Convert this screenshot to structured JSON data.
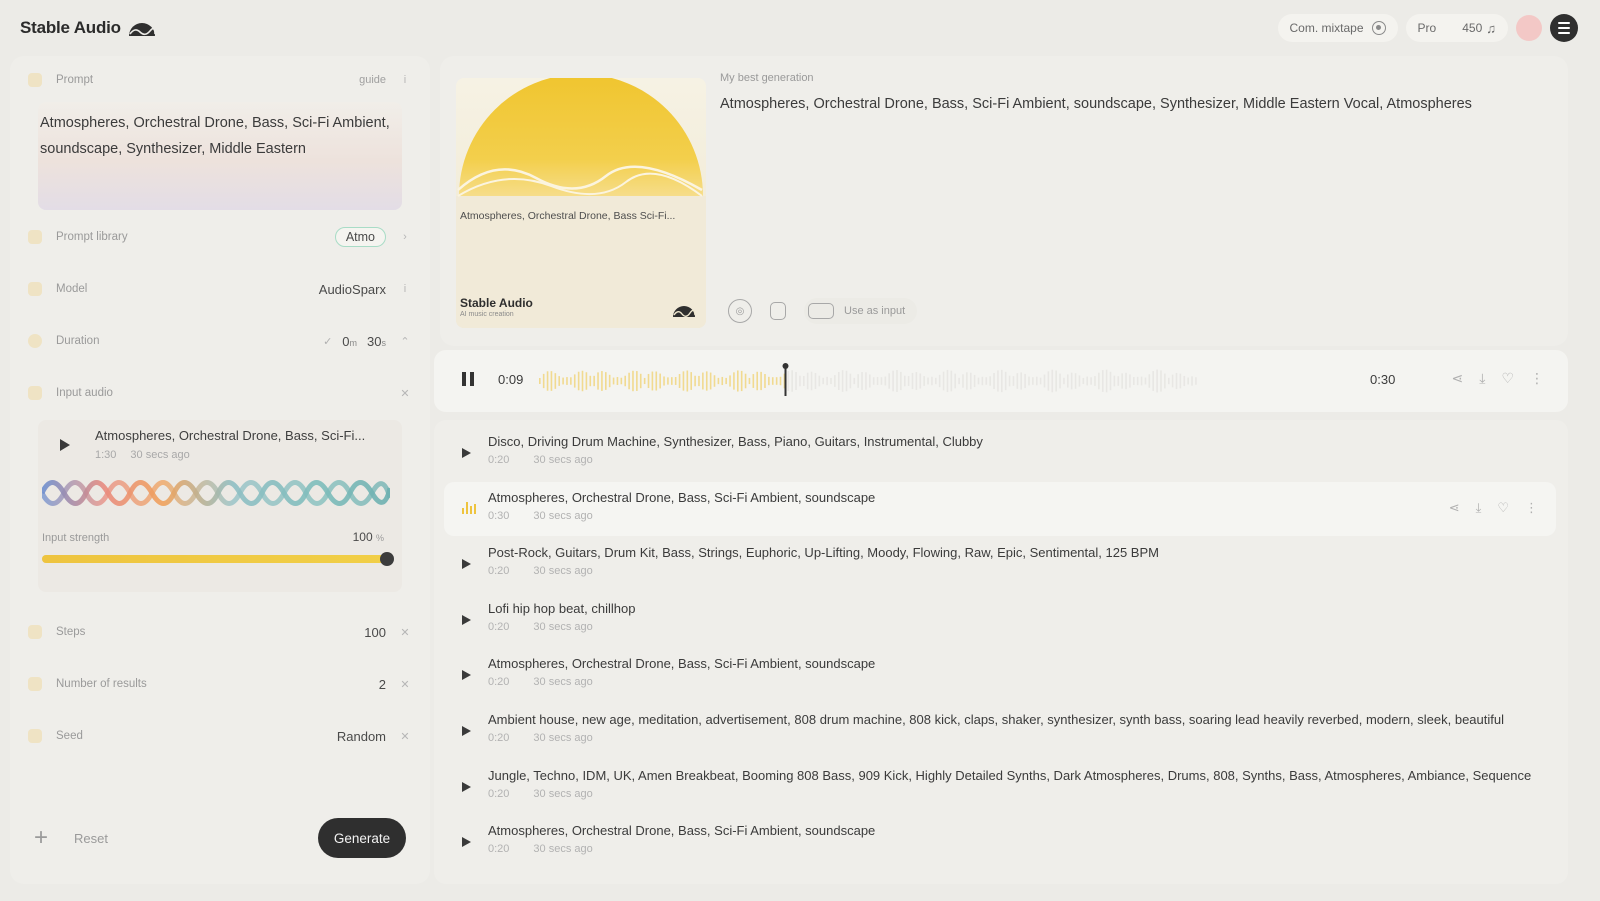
{
  "app": {
    "title": "Stable Audio"
  },
  "topbar": {
    "mixtape_label": "Com. mixtape",
    "plan_label": "Pro",
    "credits": "450"
  },
  "left": {
    "prompt": {
      "label": "Prompt",
      "guide_label": "guide",
      "text": "Atmospheres, Orchestral Drone, Bass, Sci-Fi Ambient, soundscape, Synthesizer, Middle Eastern"
    },
    "prompt_library": {
      "label": "Prompt library",
      "tag": "Atmo"
    },
    "model": {
      "label": "Model",
      "value": "AudioSparx"
    },
    "duration": {
      "label": "Duration",
      "minutes": "0",
      "minutes_unit": "m",
      "seconds": "30",
      "seconds_unit": "s"
    },
    "input_audio": {
      "label": "Input audio",
      "title": "Atmospheres, Orchestral Drone, Bass, Sci-Fi...",
      "length": "1:30",
      "age": "30 secs ago",
      "strength_label": "Input strength",
      "strength_value": "100",
      "strength_unit": "%",
      "strength_fraction": 1.0
    },
    "steps": {
      "label": "Steps",
      "value": "100"
    },
    "num_results": {
      "label": "Number of results",
      "value": "2"
    },
    "seed": {
      "label": "Seed",
      "value": "Random"
    },
    "reset_label": "Reset",
    "generate_label": "Generate"
  },
  "generation": {
    "label": "My best generation",
    "title": "Atmospheres, Orchestral Drone, Bass, Sci-Fi Ambient, soundscape, Synthesizer, Middle Eastern Vocal, Atmospheres",
    "cover_title": "Atmospheres, Orchestral Drone, Bass Sci-Fi...",
    "cover_brand": "Stable Audio",
    "cover_sub": "AI music creation",
    "use_as_input_label": "Use as input"
  },
  "player": {
    "current_time": "0:09",
    "total_time": "0:30",
    "progress_fraction": 0.375
  },
  "tracks": [
    {
      "title": "Disco, Driving Drum Machine, Synthesizer, Bass, Piano, Guitars, Instrumental, Clubby",
      "length": "0:20",
      "age": "30 secs ago",
      "active": false
    },
    {
      "title": "Atmospheres, Orchestral Drone, Bass, Sci-Fi Ambient, soundscape",
      "length": "0:30",
      "age": "30 secs ago",
      "active": true
    },
    {
      "title": "Post-Rock, Guitars, Drum Kit, Bass, Strings, Euphoric, Up-Lifting, Moody, Flowing, Raw, Epic, Sentimental, 125 BPM",
      "length": "0:20",
      "age": "30 secs ago",
      "active": false
    },
    {
      "title": "Lofi hip hop beat, chillhop",
      "length": "0:20",
      "age": "30 secs ago",
      "active": false
    },
    {
      "title": "Atmospheres, Orchestral Drone, Bass, Sci-Fi Ambient, soundscape",
      "length": "0:20",
      "age": "30 secs ago",
      "active": false
    },
    {
      "title": "Ambient house, new age, meditation, advertisement, 808 drum machine, 808 kick, claps, shaker, synthesizer, synth bass, soaring lead heavily reverbed, modern, sleek, beautiful",
      "length": "0:20",
      "age": "30 secs ago",
      "active": false
    },
    {
      "title": "Jungle, Techno, IDM, UK, Amen Breakbeat, Booming 808 Bass, 909 Kick, Highly Detailed Synths, Dark Atmospheres, Drums, 808, Synths, Bass, Atmospheres, Ambiance, Sequence",
      "length": "0:20",
      "age": "30 secs ago",
      "active": false
    },
    {
      "title": "Atmospheres, Orchestral Drone, Bass, Sci-Fi Ambient, soundscape",
      "length": "0:20",
      "age": "30 secs ago",
      "active": false
    }
  ],
  "colors": {
    "accent_yellow": "#eec43f",
    "tag_border": "#a8dcc6",
    "dark": "#2f2f2f"
  }
}
